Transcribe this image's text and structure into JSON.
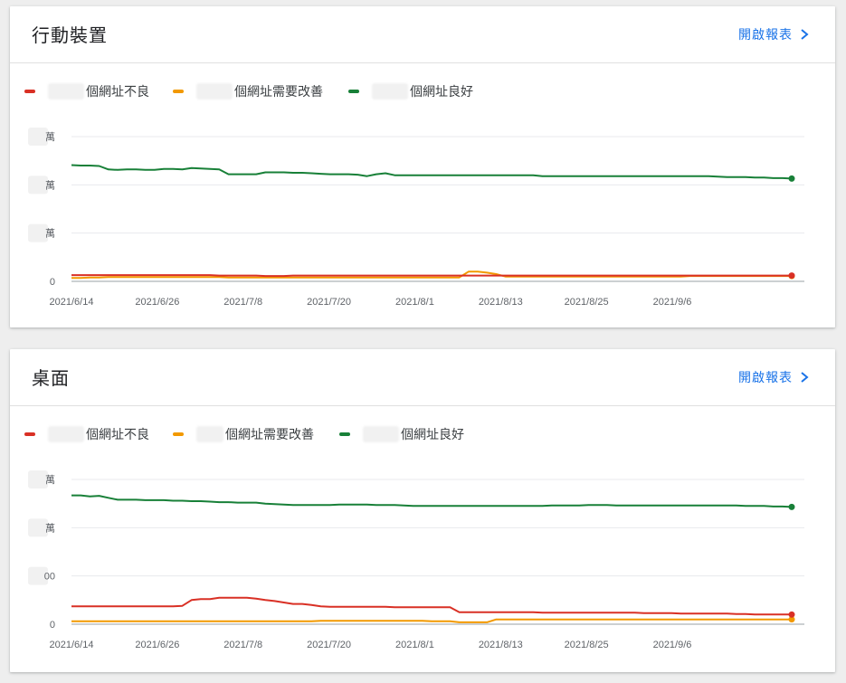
{
  "cards": [
    {
      "title": "行動裝置",
      "report_link": "開啟報表",
      "legend": [
        {
          "label": "個網址不良",
          "color": "#d93025"
        },
        {
          "label": "個網址需要改善",
          "color": "#f29900"
        },
        {
          "label": "個網址良好",
          "color": "#188038"
        }
      ],
      "chart_data": {
        "type": "line",
        "x_tick_labels": [
          "2021/6/14",
          "2021/6/26",
          "2021/7/8",
          "2021/7/20",
          "2021/8/1",
          "2021/8/13",
          "2021/8/25",
          "2021/9/6"
        ],
        "y_tick_labels": [
          "萬",
          "萬",
          "萬",
          "0"
        ],
        "grid": true,
        "legend_position": "top-left",
        "ylim": [
          0,
          3
        ],
        "series": [
          {
            "name": "個網址良好",
            "color": "#188038",
            "values": [
              2.41,
              2.4,
              2.4,
              2.39,
              2.32,
              2.31,
              2.32,
              2.32,
              2.31,
              2.31,
              2.33,
              2.33,
              2.32,
              2.35,
              2.34,
              2.33,
              2.32,
              2.22,
              2.22,
              2.22,
              2.22,
              2.26,
              2.26,
              2.26,
              2.25,
              2.25,
              2.24,
              2.23,
              2.22,
              2.22,
              2.22,
              2.21,
              2.18,
              2.22,
              2.24,
              2.2,
              2.2,
              2.2,
              2.2,
              2.2,
              2.2,
              2.2,
              2.2,
              2.2,
              2.2,
              2.2,
              2.2,
              2.2,
              2.2,
              2.2,
              2.2,
              2.18,
              2.18,
              2.18,
              2.18,
              2.18,
              2.18,
              2.18,
              2.18,
              2.18,
              2.18,
              2.18,
              2.18,
              2.18,
              2.18,
              2.18,
              2.18,
              2.18,
              2.18,
              2.18,
              2.17,
              2.16,
              2.16,
              2.16,
              2.15,
              2.15,
              2.14,
              2.14,
              2.13
            ]
          },
          {
            "name": "個網址需要改善",
            "color": "#f29900",
            "values": [
              0.07,
              0.07,
              0.08,
              0.08,
              0.09,
              0.09,
              0.09,
              0.09,
              0.09,
              0.09,
              0.09,
              0.09,
              0.09,
              0.09,
              0.09,
              0.09,
              0.09,
              0.08,
              0.08,
              0.08,
              0.08,
              0.08,
              0.08,
              0.08,
              0.08,
              0.08,
              0.08,
              0.08,
              0.08,
              0.08,
              0.08,
              0.08,
              0.08,
              0.08,
              0.08,
              0.08,
              0.08,
              0.08,
              0.08,
              0.08,
              0.08,
              0.08,
              0.08,
              0.2,
              0.2,
              0.18,
              0.15,
              0.1,
              0.1,
              0.1,
              0.1,
              0.1,
              0.1,
              0.1,
              0.1,
              0.1,
              0.1,
              0.1,
              0.1,
              0.1,
              0.1,
              0.1,
              0.1,
              0.1,
              0.1,
              0.1,
              0.1,
              0.11,
              0.11,
              0.11,
              0.11,
              0.11,
              0.11,
              0.11,
              0.11,
              0.11,
              0.11,
              0.11,
              0.11
            ]
          },
          {
            "name": "個網址不良",
            "color": "#d93025",
            "values": [
              0.13,
              0.13,
              0.13,
              0.13,
              0.13,
              0.13,
              0.13,
              0.13,
              0.13,
              0.13,
              0.13,
              0.13,
              0.13,
              0.13,
              0.13,
              0.13,
              0.12,
              0.12,
              0.12,
              0.12,
              0.12,
              0.11,
              0.11,
              0.11,
              0.12,
              0.12,
              0.12,
              0.12,
              0.12,
              0.12,
              0.12,
              0.12,
              0.12,
              0.12,
              0.12,
              0.12,
              0.12,
              0.12,
              0.12,
              0.12,
              0.12,
              0.12,
              0.12,
              0.12,
              0.12,
              0.12,
              0.12,
              0.12,
              0.12,
              0.12,
              0.12,
              0.12,
              0.12,
              0.12,
              0.12,
              0.12,
              0.12,
              0.12,
              0.12,
              0.12,
              0.12,
              0.12,
              0.12,
              0.12,
              0.12,
              0.12,
              0.12,
              0.12,
              0.12,
              0.12,
              0.12,
              0.12,
              0.12,
              0.12,
              0.12,
              0.12,
              0.12,
              0.12,
              0.12
            ]
          }
        ]
      }
    },
    {
      "title": "桌面",
      "report_link": "開啟報表",
      "legend": [
        {
          "label": "個網址不良",
          "color": "#d93025"
        },
        {
          "label": "個網址需要改善",
          "color": "#f29900"
        },
        {
          "label": "個網址良好",
          "color": "#188038"
        }
      ],
      "chart_data": {
        "type": "line",
        "x_tick_labels": [
          "2021/6/14",
          "2021/6/26",
          "2021/7/8",
          "2021/7/20",
          "2021/8/1",
          "2021/8/13",
          "2021/8/25",
          "2021/9/6"
        ],
        "y_tick_labels": [
          "萬",
          "萬",
          "00",
          "0"
        ],
        "grid": true,
        "legend_position": "top-left",
        "ylim": [
          0,
          3
        ],
        "series": [
          {
            "name": "個網址良好",
            "color": "#188038",
            "values": [
              2.67,
              2.67,
              2.65,
              2.66,
              2.62,
              2.58,
              2.58,
              2.58,
              2.57,
              2.57,
              2.57,
              2.56,
              2.56,
              2.55,
              2.55,
              2.54,
              2.53,
              2.53,
              2.52,
              2.52,
              2.52,
              2.5,
              2.49,
              2.48,
              2.47,
              2.47,
              2.47,
              2.47,
              2.47,
              2.48,
              2.48,
              2.48,
              2.48,
              2.47,
              2.47,
              2.47,
              2.46,
              2.45,
              2.45,
              2.45,
              2.45,
              2.45,
              2.45,
              2.45,
              2.45,
              2.45,
              2.45,
              2.45,
              2.45,
              2.45,
              2.45,
              2.45,
              2.46,
              2.46,
              2.46,
              2.46,
              2.47,
              2.47,
              2.47,
              2.46,
              2.46,
              2.46,
              2.46,
              2.46,
              2.46,
              2.46,
              2.46,
              2.46,
              2.46,
              2.46,
              2.46,
              2.46,
              2.46,
              2.45,
              2.45,
              2.45,
              2.44,
              2.44,
              2.43
            ]
          },
          {
            "name": "個網址需要改善",
            "color": "#f29900",
            "values": [
              0.06,
              0.06,
              0.06,
              0.06,
              0.06,
              0.06,
              0.06,
              0.06,
              0.06,
              0.06,
              0.06,
              0.06,
              0.06,
              0.06,
              0.06,
              0.06,
              0.06,
              0.06,
              0.06,
              0.06,
              0.06,
              0.06,
              0.06,
              0.06,
              0.06,
              0.06,
              0.06,
              0.07,
              0.07,
              0.07,
              0.07,
              0.07,
              0.07,
              0.07,
              0.07,
              0.07,
              0.07,
              0.07,
              0.07,
              0.06,
              0.06,
              0.06,
              0.04,
              0.04,
              0.04,
              0.04,
              0.1,
              0.1,
              0.1,
              0.1,
              0.1,
              0.1,
              0.1,
              0.1,
              0.1,
              0.1,
              0.1,
              0.1,
              0.1,
              0.1,
              0.1,
              0.1,
              0.1,
              0.1,
              0.1,
              0.1,
              0.1,
              0.1,
              0.1,
              0.1,
              0.1,
              0.1,
              0.1,
              0.1,
              0.1,
              0.1,
              0.1,
              0.1,
              0.1
            ]
          },
          {
            "name": "個網址不良",
            "color": "#d93025",
            "values": [
              0.37,
              0.37,
              0.37,
              0.37,
              0.37,
              0.37,
              0.37,
              0.37,
              0.37,
              0.37,
              0.37,
              0.37,
              0.38,
              0.5,
              0.52,
              0.52,
              0.55,
              0.55,
              0.55,
              0.55,
              0.53,
              0.5,
              0.48,
              0.45,
              0.42,
              0.42,
              0.4,
              0.37,
              0.36,
              0.36,
              0.36,
              0.36,
              0.36,
              0.36,
              0.36,
              0.35,
              0.35,
              0.35,
              0.35,
              0.35,
              0.35,
              0.35,
              0.25,
              0.25,
              0.25,
              0.25,
              0.25,
              0.25,
              0.25,
              0.25,
              0.25,
              0.24,
              0.24,
              0.24,
              0.24,
              0.24,
              0.24,
              0.24,
              0.24,
              0.24,
              0.24,
              0.24,
              0.23,
              0.23,
              0.23,
              0.23,
              0.22,
              0.22,
              0.22,
              0.22,
              0.22,
              0.22,
              0.21,
              0.21,
              0.2,
              0.2,
              0.2,
              0.2,
              0.2
            ]
          }
        ]
      }
    }
  ]
}
